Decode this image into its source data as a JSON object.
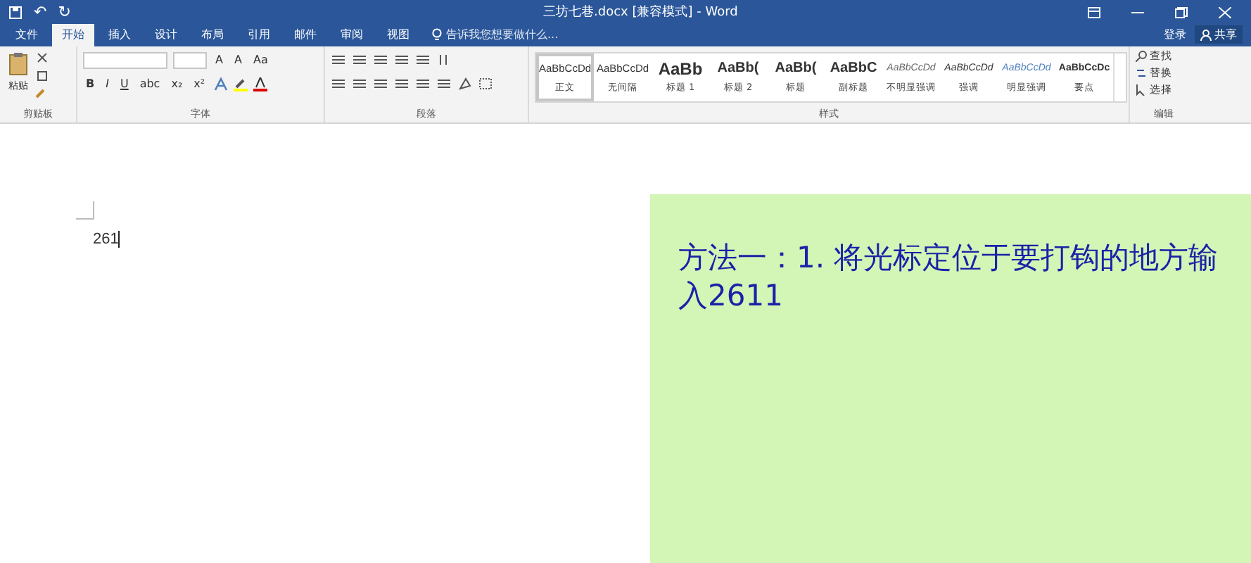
{
  "window": {
    "title": "三坊七巷.docx [兼容模式] - Word"
  },
  "quick_access": {
    "undo_label": "↶",
    "redo_label": "↻"
  },
  "tabs": [
    {
      "label": "文件",
      "selected": false
    },
    {
      "label": "开始",
      "selected": true
    },
    {
      "label": "插入",
      "selected": false
    },
    {
      "label": "设计",
      "selected": false
    },
    {
      "label": "布局",
      "selected": false
    },
    {
      "label": "引用",
      "selected": false
    },
    {
      "label": "邮件",
      "selected": false
    },
    {
      "label": "审阅",
      "selected": false
    },
    {
      "label": "视图",
      "selected": false
    }
  ],
  "tell_me": {
    "placeholder": "告诉我您想要做什么..."
  },
  "account": {
    "sign_in": "登录",
    "share": "共享"
  },
  "ribbon": {
    "clipboard": {
      "paste": "粘贴",
      "label": "剪贴板"
    },
    "font": {
      "row1": [
        "A",
        "A",
        "Aa"
      ],
      "row2": [
        "B",
        "I",
        "U",
        "abc",
        "x₂",
        "x²"
      ],
      "label": "字体"
    },
    "paragraph": {
      "label": "段落"
    },
    "styles": {
      "label": "样式",
      "items": [
        {
          "preview": "AaBbCcDd",
          "name": "正文",
          "kind": "normal",
          "selected": true
        },
        {
          "preview": "AaBbCcDd",
          "name": "无间隔",
          "kind": "normal",
          "selected": false
        },
        {
          "preview": "AaBb",
          "name": "标题 1",
          "kind": "heading1",
          "selected": false
        },
        {
          "preview": "AaBb(",
          "name": "标题 2",
          "kind": "heading2",
          "selected": false
        },
        {
          "preview": "AaBb(",
          "name": "标题",
          "kind": "heading2",
          "selected": false
        },
        {
          "preview": "AaBbC",
          "name": "副标题",
          "kind": "heading2",
          "selected": false
        },
        {
          "preview": "AaBbCcDd",
          "name": "不明显强调",
          "kind": "subtle",
          "selected": false
        },
        {
          "preview": "AaBbCcDd",
          "name": "强调",
          "kind": "emphasis",
          "selected": false
        },
        {
          "preview": "AaBbCcDd",
          "name": "明显强调",
          "kind": "intense",
          "selected": false
        },
        {
          "preview": "AaBbCcDc",
          "name": "要点",
          "kind": "strong",
          "selected": false
        }
      ]
    },
    "editing": {
      "label": "编辑",
      "items": [
        "查找",
        "替换",
        "选择"
      ]
    }
  },
  "document": {
    "text": "261"
  },
  "overlay": {
    "text": "方法一：1. 将光标定位于要打钩的地方输入2611"
  }
}
